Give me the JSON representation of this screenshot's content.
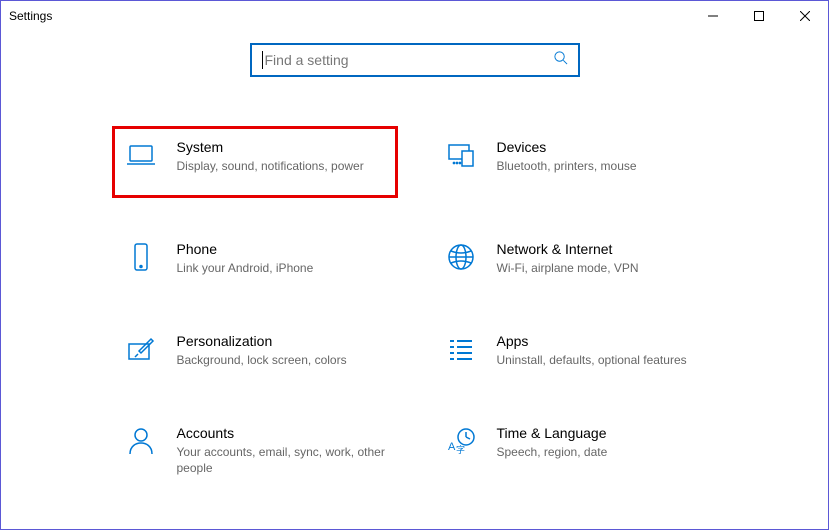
{
  "titlebar": {
    "title": "Settings"
  },
  "search": {
    "placeholder": "Find a setting"
  },
  "categories": [
    {
      "id": "system",
      "title": "System",
      "desc": "Display, sound, notifications, power",
      "highlighted": true
    },
    {
      "id": "devices",
      "title": "Devices",
      "desc": "Bluetooth, printers, mouse"
    },
    {
      "id": "phone",
      "title": "Phone",
      "desc": "Link your Android, iPhone"
    },
    {
      "id": "network",
      "title": "Network & Internet",
      "desc": "Wi-Fi, airplane mode, VPN"
    },
    {
      "id": "personalization",
      "title": "Personalization",
      "desc": "Background, lock screen, colors"
    },
    {
      "id": "apps",
      "title": "Apps",
      "desc": "Uninstall, defaults, optional features"
    },
    {
      "id": "accounts",
      "title": "Accounts",
      "desc": "Your accounts, email, sync, work, other people"
    },
    {
      "id": "time",
      "title": "Time & Language",
      "desc": "Speech, region, date"
    }
  ]
}
